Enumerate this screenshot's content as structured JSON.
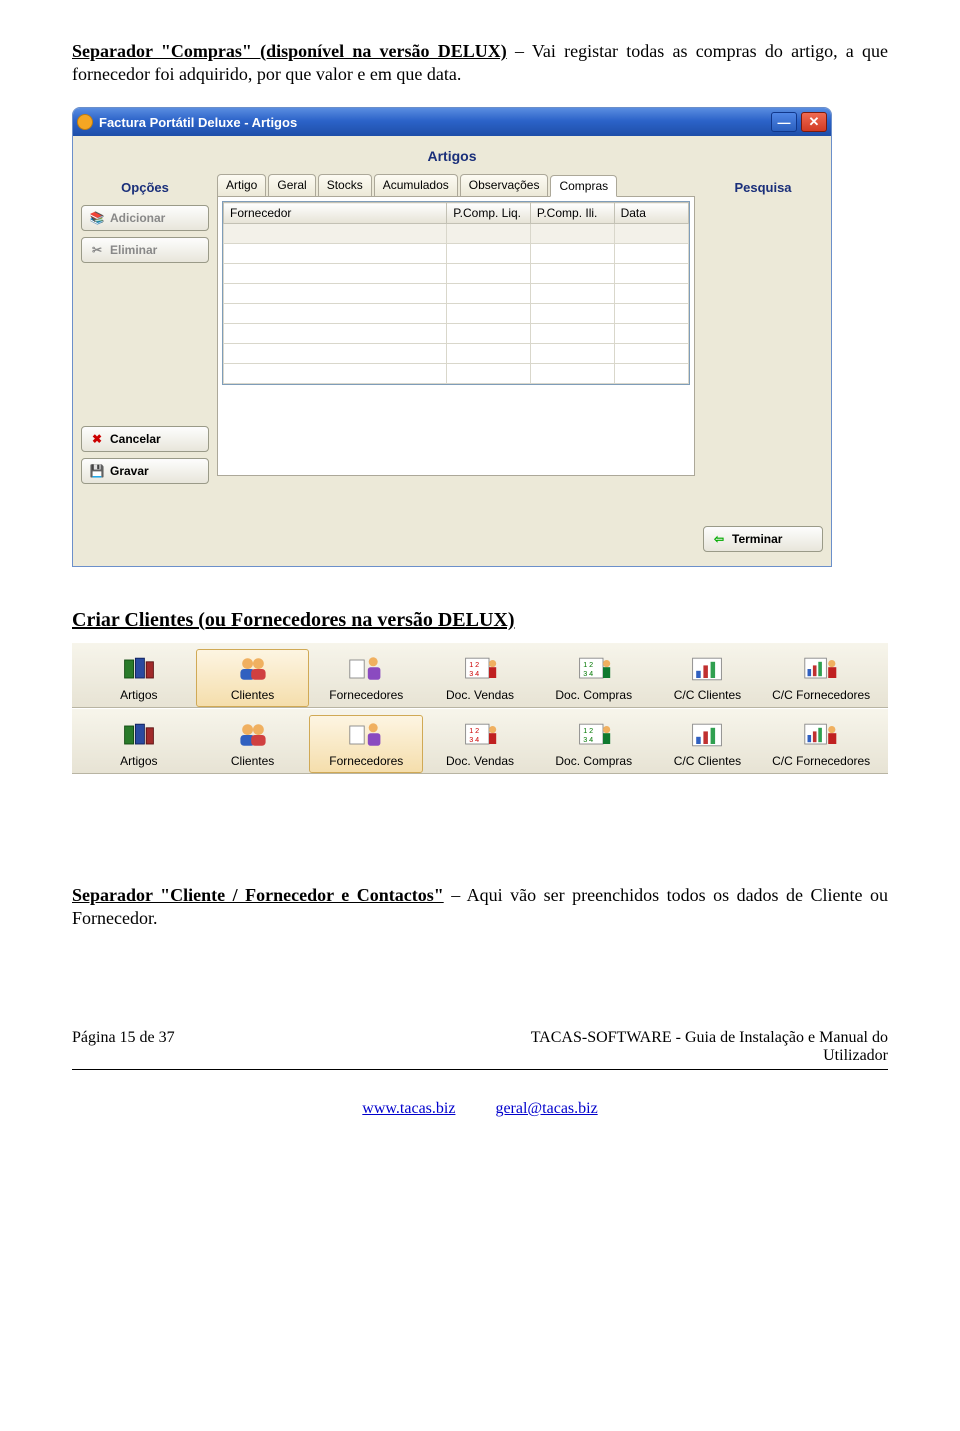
{
  "intro": {
    "title": "Separador \"Compras\" (disponível na versão DELUX)",
    "text": " – Vai registar todas as compras do artigo, a que fornecedor foi adquirido, por que valor e em que data."
  },
  "window": {
    "title": "Factura Portátil Deluxe - Artigos",
    "panel_title": "Artigos",
    "left_header": "Opções",
    "right_header": "Pesquisa",
    "buttons": {
      "adicionar": "Adicionar",
      "eliminar": "Eliminar",
      "cancelar": "Cancelar",
      "gravar": "Gravar",
      "terminar": "Terminar"
    },
    "tabs": [
      "Artigo",
      "Geral",
      "Stocks",
      "Acumulados",
      "Observações",
      "Compras"
    ],
    "active_tab": "Compras",
    "grid_headers": [
      "Fornecedor",
      "P.Comp. Liq.",
      "P.Comp. Ili.",
      "Data"
    ]
  },
  "section2_title": "Criar Clientes (ou Fornecedores na versão DELUX)",
  "toolbar_labels": [
    "Artigos",
    "Clientes",
    "Fornecedores",
    "Doc. Vendas",
    "Doc. Compras",
    "C/C Clientes",
    "C/C Fornecedores"
  ],
  "toolbar_rows": [
    {
      "selected_index": 1
    },
    {
      "selected_index": 2
    }
  ],
  "para3": {
    "title": "Separador \"Cliente / Fornecedor e Contactos\"",
    "text": " – Aqui vão ser preenchidos todos os dados de Cliente ou Fornecedor."
  },
  "footer": {
    "left": "Página 15 de 37",
    "right_prefix": "TACAS-SOFTWARE  -  ",
    "right_rest": "Guia de Instalação e Manual do",
    "right_line2": "Utilizador",
    "link1": "www.tacas.biz",
    "link2": "geral@tacas.biz"
  }
}
